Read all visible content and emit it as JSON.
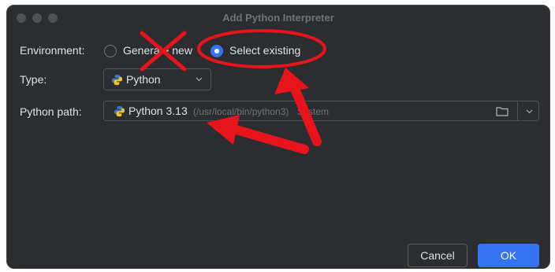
{
  "window": {
    "title": "Add Python Interpreter"
  },
  "environment": {
    "label": "Environment:",
    "options": [
      {
        "label": "Generate new",
        "selected": false
      },
      {
        "label": "Select existing",
        "selected": true
      }
    ]
  },
  "type": {
    "label": "Type:",
    "value": "Python"
  },
  "python_path": {
    "label": "Python path:",
    "value": "Python 3.13",
    "detail": "(/usr/local/bin/python3)",
    "suffix": "System"
  },
  "buttons": {
    "cancel": "Cancel",
    "ok": "OK"
  },
  "icons": {
    "python": "python-logo-icon",
    "folder": "folder-icon",
    "dropdown": "chevron-down-icon"
  },
  "colors": {
    "accent": "#3574f0",
    "annotation": "#e8141b",
    "background": "#2b2d30"
  }
}
